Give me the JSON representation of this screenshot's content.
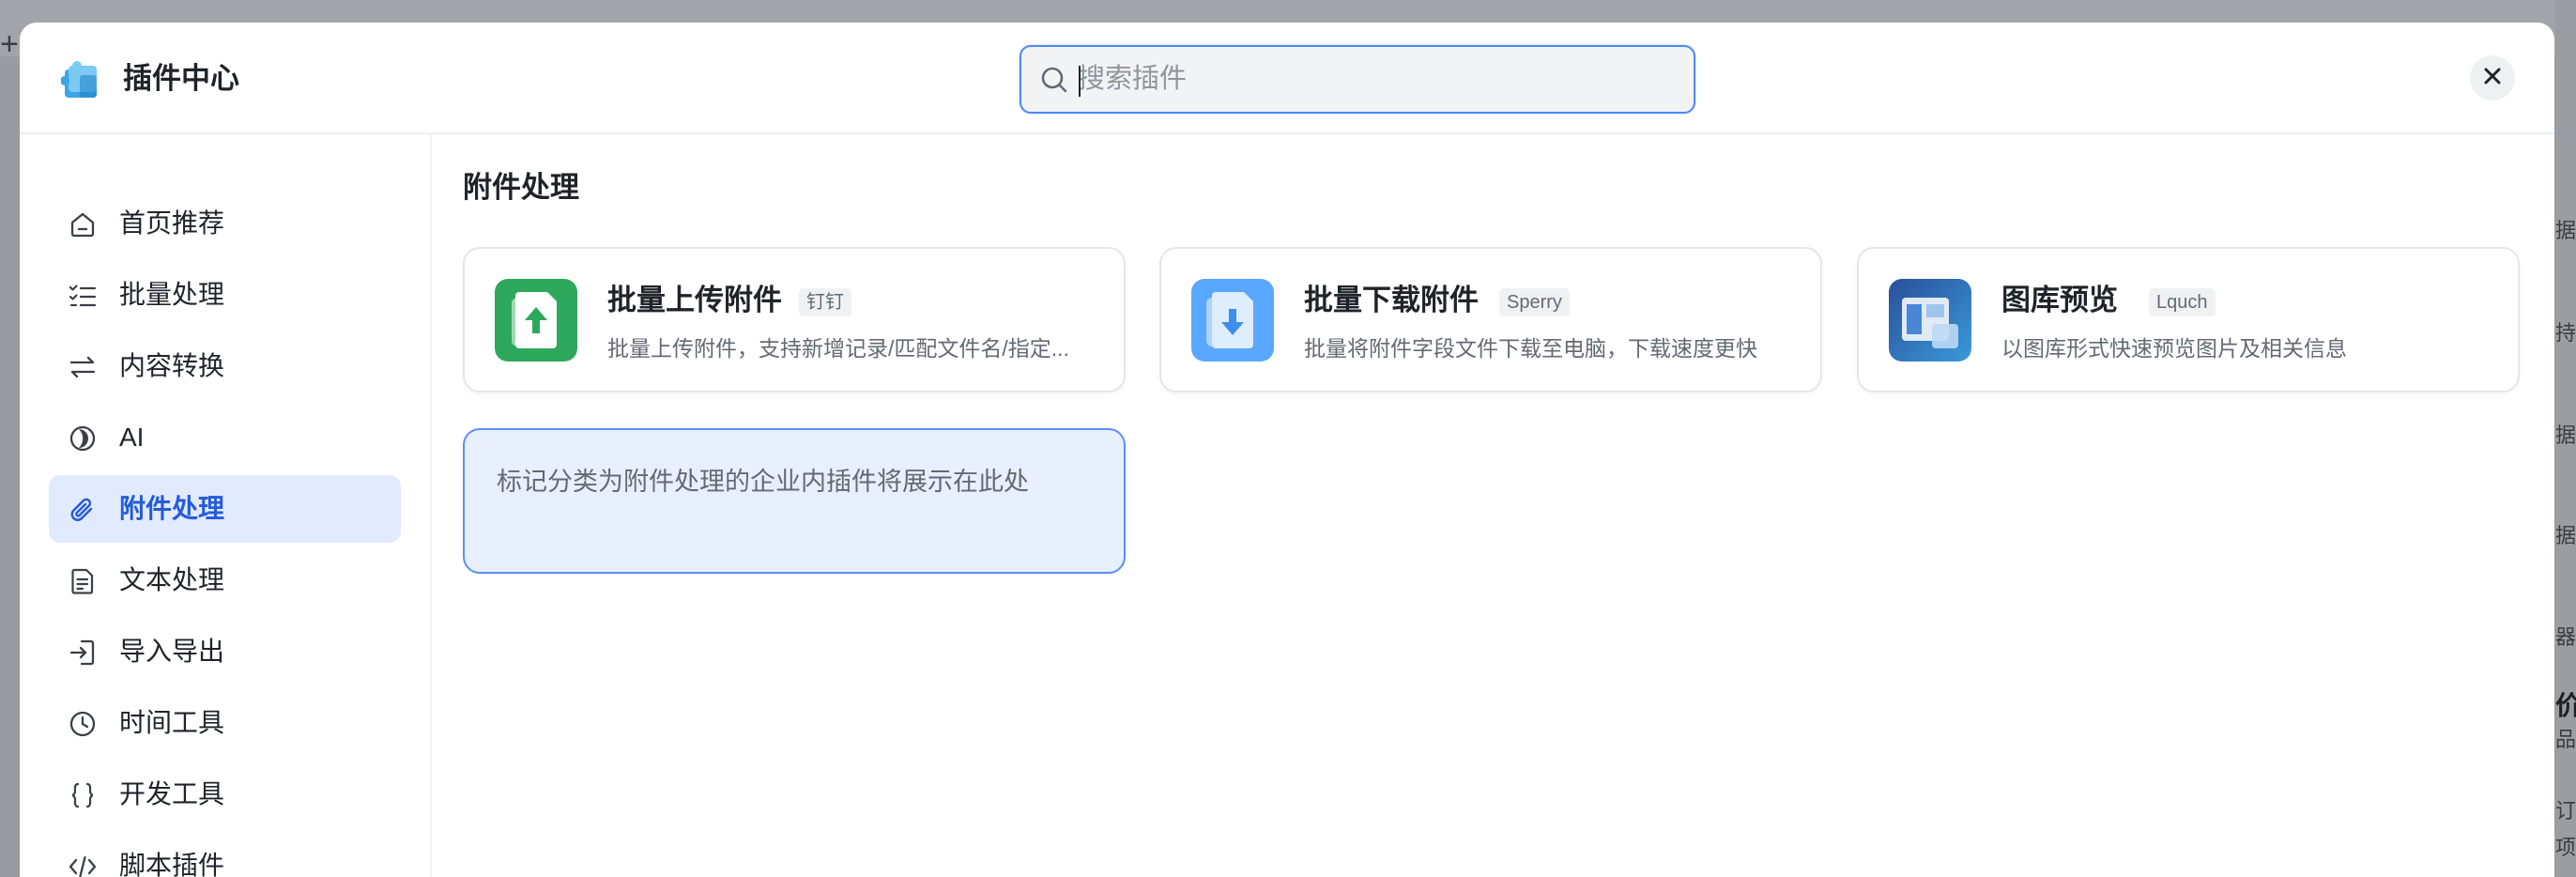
{
  "modal": {
    "title": "插件中心",
    "search_placeholder": "搜索插件",
    "logo_icon": "puzzle-logo-icon",
    "close_icon": "close-icon"
  },
  "sidebar": {
    "items": [
      {
        "label": "首页推荐",
        "icon": "home-icon",
        "active": false
      },
      {
        "label": "批量处理",
        "icon": "checklist-icon",
        "active": false
      },
      {
        "label": "内容转换",
        "icon": "swap-arrows-icon",
        "active": false
      },
      {
        "label": "AI",
        "icon": "ai-icon",
        "active": false
      },
      {
        "label": "附件处理",
        "icon": "paperclip-icon",
        "active": true
      },
      {
        "label": "文本处理",
        "icon": "document-icon",
        "active": false
      },
      {
        "label": "导入导出",
        "icon": "import-icon",
        "active": false
      },
      {
        "label": "时间工具",
        "icon": "clock-icon",
        "active": false
      },
      {
        "label": "开发工具",
        "icon": "braces-icon",
        "active": false
      },
      {
        "label": "脚本插件",
        "icon": "code-icon",
        "active": false
      }
    ]
  },
  "main": {
    "section_title": "附件处理",
    "cards": [
      {
        "name": "批量上传附件",
        "author": "钉钉",
        "desc": "批量上传附件，支持新增记录/匹配文件名/指定...",
        "icon": "upload-file-icon",
        "accent": "#2ea85c"
      },
      {
        "name": "批量下载附件",
        "author": "Sperry",
        "desc": "批量将附件字段文件下载至电脑，下载速度更快",
        "icon": "download-file-icon",
        "accent": "#5aa7ff"
      },
      {
        "name": "图库预览",
        "author": "Lquch",
        "desc": "以图库形式快速预览图片及相关信息",
        "icon": "gallery-icon",
        "accent": "#2f5fa8"
      }
    ],
    "placeholder_text": "标记分类为附件处理的企业内插件将展示在此处"
  },
  "colors": {
    "accent_blue": "#245bdb",
    "active_bg": "#e1eaff",
    "placeholder_bg": "#e8effd",
    "text_primary": "#1f2329",
    "text_secondary": "#646a73"
  },
  "background": {
    "fragments": [
      "据",
      "持",
      "据",
      "据",
      "器，",
      "价",
      "品",
      "订",
      "项"
    ]
  }
}
